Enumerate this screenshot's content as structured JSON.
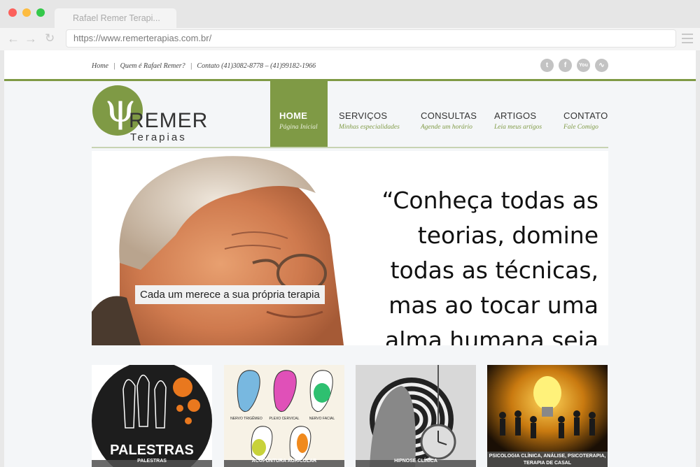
{
  "browser": {
    "tab_title": "Rafael Remer Terapi...",
    "url": "https://www.remerterapias.com.br/"
  },
  "topbar": {
    "links": [
      "Home",
      "Quem é Rafael Remer?",
      "Contato (41)3082-8778 – (41)99182-1966"
    ],
    "social_icons": [
      "twitter-icon",
      "facebook-icon",
      "youtube-icon",
      "rss-icon"
    ]
  },
  "logo": {
    "name": "REMER",
    "sub": "Terapias"
  },
  "nav": [
    {
      "label": "HOME",
      "sub": "Página Inicial",
      "active": true
    },
    {
      "label": "SERVIÇOS",
      "sub": "Minhas especialidades",
      "active": false
    },
    {
      "label": "CONSULTAS",
      "sub": "Agende um horário",
      "active": false
    },
    {
      "label": "ARTIGOS",
      "sub": "Leia meus artigos",
      "active": false
    },
    {
      "label": "CONTATO",
      "sub": "Fale Comigo",
      "active": false
    }
  ],
  "hero": {
    "caption": "Cada um merece a sua própria terapia",
    "quote": "“Conheça todas as teorias, domine todas as técnicas, mas ao tocar uma alma humana seja"
  },
  "cards": [
    {
      "image_text": "PALESTRAS",
      "bar_text": "PALESTRAS"
    },
    {
      "image_labels": [
        "NERVO TRIGÊMEO",
        "PLEXO CERVICAL",
        "NERVO FACIAL"
      ],
      "bar_text": "ACUPUNTURA AURICULAR"
    },
    {
      "bar_text": "HIPNOSE CLÍNICA"
    },
    {
      "bar_text": "PSICOLOGIA CLÍNICA, ANÁLISE, PSICOTERAPIA, TERAPIA DE CASAL"
    }
  ],
  "colors": {
    "accent": "#7f9a45"
  }
}
